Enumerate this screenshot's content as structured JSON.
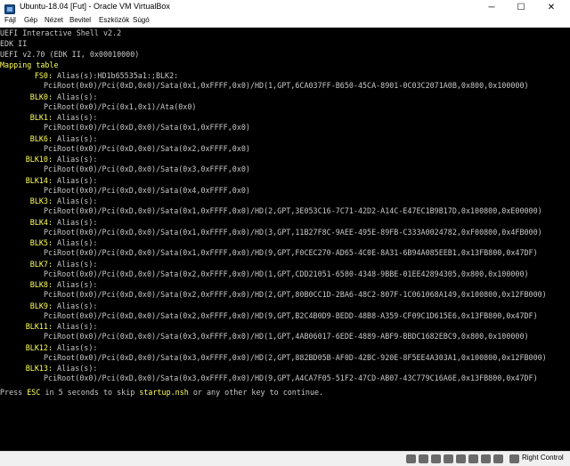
{
  "window": {
    "title": "Ubuntu-18.04 [Fut] - Oracle VM VirtualBox",
    "min": "─",
    "max": "☐",
    "close": "✕"
  },
  "menu": [
    "Fájl",
    "Gép",
    "Nézet",
    "Bevitel",
    "Eszközök",
    "Súgó"
  ],
  "console": {
    "header": [
      "UEFI Interactive Shell v2.2",
      "EDK II",
      "UEFI v2.70 (EDK II, 0x00010000)"
    ],
    "mapping_title": "Mapping table",
    "entries": [
      {
        "label": "FS0:",
        "alias": " Alias(s):HD1b65535a1:;BLK2:",
        "path": "PciRoot(0x0)/Pci(0xD,0x0)/Sata(0x1,0xFFFF,0x0)/HD(1,GPT,6CA037FF-B650-45CA-8901-0C03C2071A0B,0x800,0x100000)"
      },
      {
        "label": "BLK0:",
        "alias": " Alias(s):",
        "path": "PciRoot(0x0)/Pci(0x1,0x1)/Ata(0x0)"
      },
      {
        "label": "BLK1:",
        "alias": " Alias(s):",
        "path": "PciRoot(0x0)/Pci(0xD,0x0)/Sata(0x1,0xFFFF,0x0)"
      },
      {
        "label": "BLK6:",
        "alias": " Alias(s):",
        "path": "PciRoot(0x0)/Pci(0xD,0x0)/Sata(0x2,0xFFFF,0x0)"
      },
      {
        "label": "BLK10:",
        "alias": " Alias(s):",
        "path": "PciRoot(0x0)/Pci(0xD,0x0)/Sata(0x3,0xFFFF,0x0)"
      },
      {
        "label": "BLK14:",
        "alias": " Alias(s):",
        "path": "PciRoot(0x0)/Pci(0xD,0x0)/Sata(0x4,0xFFFF,0x0)"
      },
      {
        "label": "BLK3:",
        "alias": " Alias(s):",
        "path": "PciRoot(0x0)/Pci(0xD,0x0)/Sata(0x1,0xFFFF,0x0)/HD(2,GPT,3E053C16-7C71-42D2-A14C-E47EC1B9B17D,0x100800,0xE00000)"
      },
      {
        "label": "BLK4:",
        "alias": " Alias(s):",
        "path": "PciRoot(0x0)/Pci(0xD,0x0)/Sata(0x1,0xFFFF,0x0)/HD(3,GPT,11B27F8C-9AEE-495E-89FB-C333A0024782,0xF00800,0x4FB000)"
      },
      {
        "label": "BLK5:",
        "alias": " Alias(s):",
        "path": "PciRoot(0x0)/Pci(0xD,0x0)/Sata(0x1,0xFFFF,0x0)/HD(9,GPT,F0CEC270-AD65-4C0E-8A31-6B94A085EEB1,0x13FB800,0x47DF)"
      },
      {
        "label": "BLK7:",
        "alias": " Alias(s):",
        "path": "PciRoot(0x0)/Pci(0xD,0x0)/Sata(0x2,0xFFFF,0x0)/HD(1,GPT,CDD21051-6580-4348-9BBE-01EE42894305,0x800,0x100000)"
      },
      {
        "label": "BLK8:",
        "alias": " Alias(s):",
        "path": "PciRoot(0x0)/Pci(0xD,0x0)/Sata(0x2,0xFFFF,0x0)/HD(2,GPT,80B0CC1D-2BA6-48C2-807F-1C061068A149,0x100800,0x12FB000)"
      },
      {
        "label": "BLK9:",
        "alias": " Alias(s):",
        "path": "PciRoot(0x0)/Pci(0xD,0x0)/Sata(0x2,0xFFFF,0x0)/HD(9,GPT,B2C4B0D9-BEDD-48B8-A359-CF09C1D615E6,0x13FB800,0x47DF)"
      },
      {
        "label": "BLK11:",
        "alias": " Alias(s):",
        "path": "PciRoot(0x0)/Pci(0xD,0x0)/Sata(0x3,0xFFFF,0x0)/HD(1,GPT,4AB06017-6EDE-4889-ABF9-BBDC1682EBC9,0x800,0x100000)"
      },
      {
        "label": "BLK12:",
        "alias": " Alias(s):",
        "path": "PciRoot(0x0)/Pci(0xD,0x0)/Sata(0x3,0xFFFF,0x0)/HD(2,GPT,882BD05B-AF0D-42BC-920E-8F5EE4A303A1,0x100800,0x12FB000)"
      },
      {
        "label": "BLK13:",
        "alias": " Alias(s):",
        "path": "PciRoot(0x0)/Pci(0xD,0x0)/Sata(0x3,0xFFFF,0x0)/HD(9,GPT,A4CA7F05-51F2-47CD-AB07-43C779C16A6E,0x13FB800,0x47DF)"
      }
    ],
    "prompt": {
      "p1": "Press ",
      "k1": "ESC",
      "p2": " in 5 seconds to skip ",
      "k2": "startup.nsh",
      "p3": " or any other key to continue."
    }
  },
  "statusbar": {
    "host_key": "Right Control"
  },
  "colors": {
    "yellow": "#ffff55",
    "gray": "#c8c8c8",
    "console_bg": "#000000"
  }
}
